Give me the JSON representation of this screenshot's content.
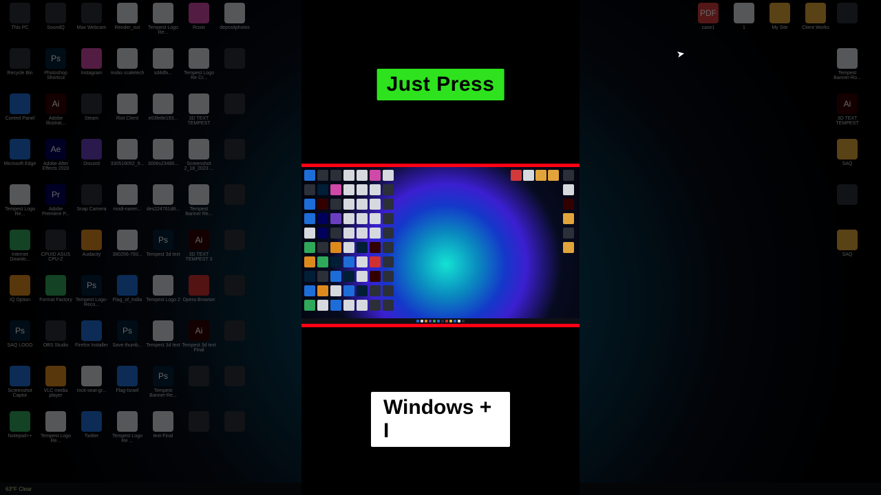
{
  "captions": {
    "top": "Just Press",
    "bottom": "Windows + I"
  },
  "taskbar_weather": "63°F Clear",
  "cursor_glyph": "➤",
  "bg_left_icons": [
    {
      "l": "This PC",
      "c": "c-dk"
    },
    {
      "l": "SoundQ",
      "c": "c-dk"
    },
    {
      "l": "Max Webcam",
      "c": "c-dk"
    },
    {
      "l": "Render_out",
      "c": "c-wh"
    },
    {
      "l": "Tempest Logo Re...",
      "c": "c-wh"
    },
    {
      "l": "Roxio",
      "c": "c-pk"
    },
    {
      "l": "depositphotos",
      "c": "c-wh"
    },
    {
      "l": "Recycle Bin",
      "c": "c-dk"
    },
    {
      "l": "Photoshop Shortcut",
      "c": "c-ps",
      "g": "Ps"
    },
    {
      "l": "Instagram",
      "c": "c-pk"
    },
    {
      "l": "mobo scaletech",
      "c": "c-wh"
    },
    {
      "l": "sd4dfx...",
      "c": "c-wh"
    },
    {
      "l": "Tempest Logo Re Cr...",
      "c": "c-wh"
    },
    {
      "l": "",
      "c": "c-dk"
    },
    {
      "l": "Control Panel",
      "c": "c-bl"
    },
    {
      "l": "Adobe Illustrat...",
      "c": "c-ai",
      "g": "Ai"
    },
    {
      "l": "Steam",
      "c": "c-dk"
    },
    {
      "l": "Riot Client",
      "c": "c-wh"
    },
    {
      "l": "e03fe8e193...",
      "c": "c-wh"
    },
    {
      "l": "3D TEXT TEMPEST",
      "c": "c-wh"
    },
    {
      "l": "",
      "c": "c-dk"
    },
    {
      "l": "Microsoft Edge",
      "c": "c-bl"
    },
    {
      "l": "Adobe After Effects 2020",
      "c": "c-ae",
      "g": "Ae"
    },
    {
      "l": "Discord",
      "c": "c-pu"
    },
    {
      "l": "330519052_9...",
      "c": "c-wh"
    },
    {
      "l": "3006s23480...",
      "c": "c-wh"
    },
    {
      "l": "Screenshot 2_18_2023 ...",
      "c": "c-wh"
    },
    {
      "l": "",
      "c": "c-dk"
    },
    {
      "l": "Tempest Logo Re...",
      "c": "c-wh"
    },
    {
      "l": "Adobe Premiere P...",
      "c": "c-pr",
      "g": "Pr"
    },
    {
      "l": "Snap Camera",
      "c": "c-dk"
    },
    {
      "l": "modi-naren...",
      "c": "c-wh"
    },
    {
      "l": "des224761d8...",
      "c": "c-wh"
    },
    {
      "l": "Tempest Banner Re...",
      "c": "c-wh"
    },
    {
      "l": "",
      "c": "c-dk"
    },
    {
      "l": "Internet Downlo...",
      "c": "c-gr"
    },
    {
      "l": "CPUID ASUS CPU-Z",
      "c": "c-dk"
    },
    {
      "l": "Audacity",
      "c": "c-or"
    },
    {
      "l": "380256-793...",
      "c": "c-wh"
    },
    {
      "l": "Tempest 3d text",
      "c": "c-ps",
      "g": "Ps"
    },
    {
      "l": "3D TEXT TEMPEST 3",
      "c": "c-ai",
      "g": "Ai"
    },
    {
      "l": "",
      "c": "c-dk"
    },
    {
      "l": "IQ Option",
      "c": "c-or"
    },
    {
      "l": "Format Factory",
      "c": "c-gr"
    },
    {
      "l": "Tempest Logo-Reco...",
      "c": "c-ps",
      "g": "Ps"
    },
    {
      "l": "Flag_of_India",
      "c": "c-bl"
    },
    {
      "l": "Tempest Logo 2",
      "c": "c-wh"
    },
    {
      "l": "Opera Browser",
      "c": "c-rd"
    },
    {
      "l": "",
      "c": "c-dk"
    },
    {
      "l": "SAQ LOGO",
      "c": "c-ps",
      "g": "Ps"
    },
    {
      "l": "OBS Studio",
      "c": "c-dk"
    },
    {
      "l": "Firefox Installer",
      "c": "c-bl"
    },
    {
      "l": "Save thumb...",
      "c": "c-ps",
      "g": "Ps"
    },
    {
      "l": "Tempest 3d text",
      "c": "c-wh"
    },
    {
      "l": "Tempest 3d text Final",
      "c": "c-ai",
      "g": "Ai"
    },
    {
      "l": "",
      "c": "c-dk"
    },
    {
      "l": "Screenshot Captor",
      "c": "c-bl"
    },
    {
      "l": "VLC media player",
      "c": "c-or"
    },
    {
      "l": "rock-seat-gr...",
      "c": "c-wh"
    },
    {
      "l": "Flag-Israel",
      "c": "c-bl"
    },
    {
      "l": "Tempest Banner-Re...",
      "c": "c-ps",
      "g": "Ps"
    },
    {
      "l": "",
      "c": "c-dk"
    },
    {
      "l": "",
      "c": "c-dk"
    },
    {
      "l": "Notepad++",
      "c": "c-gr"
    },
    {
      "l": "Tempest Logo Re...",
      "c": "c-wh"
    },
    {
      "l": "Twitter",
      "c": "c-bl"
    },
    {
      "l": "Tempest Logo Re ...",
      "c": "c-wh"
    },
    {
      "l": "text-Final",
      "c": "c-wh"
    },
    {
      "l": "",
      "c": "c-dk"
    },
    {
      "l": "",
      "c": "c-dk"
    }
  ],
  "bg_tr_icons": [
    {
      "l": "case1",
      "c": "pdf",
      "g": "PDF"
    },
    {
      "l": "1",
      "c": "c-wh"
    },
    {
      "l": "My Site",
      "c": "fold"
    },
    {
      "l": "Client Works",
      "c": "fold"
    }
  ],
  "bg_right_icons": [
    {
      "l": "",
      "c": "c-dk"
    },
    {
      "l": "Tempest Banner-Ro...",
      "c": "c-wh"
    },
    {
      "l": "3D TEXT TEMPEST",
      "c": "c-ai",
      "g": "Ai"
    },
    {
      "l": "SAQ",
      "c": "fold"
    },
    {
      "l": "",
      "c": "c-dk"
    },
    {
      "l": "SAQ",
      "c": "fold"
    }
  ],
  "mini_left_colors": [
    "c-bl",
    "c-dk",
    "c-dk",
    "c-wh",
    "c-wh",
    "c-pk",
    "c-wh",
    "c-dk",
    "c-ps",
    "c-pk",
    "c-wh",
    "c-wh",
    "c-wh",
    "c-dk",
    "c-bl",
    "c-ai",
    "c-dk",
    "c-wh",
    "c-wh",
    "c-wh",
    "c-dk",
    "c-bl",
    "c-ae",
    "c-pu",
    "c-wh",
    "c-wh",
    "c-wh",
    "c-dk",
    "c-wh",
    "c-pr",
    "c-dk",
    "c-wh",
    "c-wh",
    "c-wh",
    "c-dk",
    "c-gr",
    "c-dk",
    "c-or",
    "c-wh",
    "c-ps",
    "c-ai",
    "c-dk",
    "c-or",
    "c-gr",
    "c-ps",
    "c-bl",
    "c-wh",
    "c-rd",
    "c-dk",
    "c-ps",
    "c-dk",
    "c-bl",
    "c-ps",
    "c-wh",
    "c-ai",
    "c-dk",
    "c-bl",
    "c-or",
    "c-wh",
    "c-bl",
    "c-ps",
    "c-dk",
    "c-dk",
    "c-gr",
    "c-wh",
    "c-bl",
    "c-wh",
    "c-wh",
    "c-dk",
    "c-dk"
  ],
  "mini_tr_colors": [
    "pdf",
    "c-wh",
    "fold",
    "fold"
  ],
  "mini_right_colors": [
    "c-dk",
    "c-wh",
    "c-ai",
    "fold",
    "c-dk",
    "fold"
  ],
  "mini_task_colors": [
    "c-bl",
    "c-wh",
    "c-or",
    "c-pu",
    "c-gr",
    "c-bl",
    "c-dk",
    "c-rd",
    "c-ye",
    "c-bl",
    "c-wh",
    "c-dk"
  ]
}
